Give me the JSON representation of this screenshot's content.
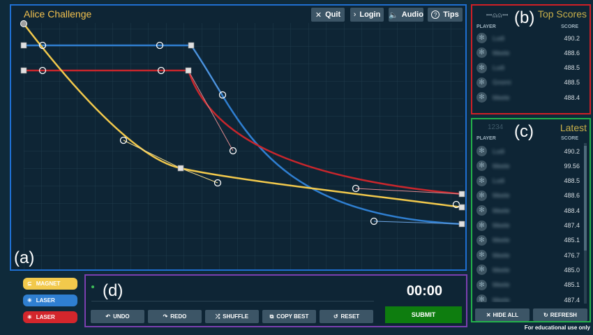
{
  "game": {
    "title": "Alice Challenge",
    "top_buttons": [
      {
        "label": "Quit",
        "icon": "close-icon",
        "glyph": "✕"
      },
      {
        "label": "Login",
        "icon": "chevron-right-icon",
        "glyph": "›"
      },
      {
        "label": "Audio",
        "icon": "speaker-icon",
        "glyph": "🔈"
      },
      {
        "label": "Tips",
        "icon": "question-icon",
        "glyph": "?"
      }
    ],
    "region_label": "(a)"
  },
  "top_scores": {
    "region_label": "(b)",
    "title": "Top Scores",
    "col_player": "PLAYER",
    "col_score": "SCORE",
    "rows": [
      {
        "name": "Ludi",
        "score": "490.2"
      },
      {
        "name": "Meele",
        "score": "488.6"
      },
      {
        "name": "Ludi",
        "score": "488.5"
      },
      {
        "name": "Gnomi",
        "score": "488.5"
      },
      {
        "name": "Meele",
        "score": "488.4"
      }
    ]
  },
  "latest": {
    "region_label": "(c)",
    "badge": "1234",
    "title": "Latest",
    "col_player": "PLAYER",
    "col_score": "SCORE",
    "rows": [
      {
        "name": "Ludi",
        "score": "490.2"
      },
      {
        "name": "Meele",
        "score": "99.56"
      },
      {
        "name": "Ludi",
        "score": "488.5"
      },
      {
        "name": "Meele",
        "score": "488.6"
      },
      {
        "name": "Meele",
        "score": "488.4"
      },
      {
        "name": "Meele",
        "score": "487.4"
      },
      {
        "name": "Meele",
        "score": "485.1"
      },
      {
        "name": "Meele",
        "score": "476.7"
      },
      {
        "name": "Meele",
        "score": "485.0"
      },
      {
        "name": "Meele",
        "score": "485.1"
      },
      {
        "name": "Meele",
        "score": "487.4"
      }
    ],
    "hide_all_label": "HIDE ALL",
    "refresh_label": "REFRESH"
  },
  "pieces": [
    {
      "label": "MAGNET",
      "color": "#f2c94c",
      "glyph": "⊆"
    },
    {
      "label": "LASER",
      "color": "#2f7fd1",
      "glyph": "✳"
    },
    {
      "label": "LASER",
      "color": "#d3262c",
      "glyph": "✳"
    }
  ],
  "controls": {
    "region_label": "(d)",
    "timer": "00:00",
    "buttons": [
      {
        "label": "UNDO",
        "glyph": "↶"
      },
      {
        "label": "REDO",
        "glyph": "↷"
      },
      {
        "label": "SHUFFLE",
        "glyph": "⤮"
      },
      {
        "label": "COPY BEST",
        "glyph": "⧉"
      },
      {
        "label": "RESET",
        "glyph": "↺"
      }
    ],
    "submit_label": "SUBMIT"
  },
  "footnote": "For educational use only",
  "colors": {
    "yellow_curve": "#f2c94c",
    "blue_curve": "#2f7fd1",
    "red_curve": "#c8262c",
    "panel_a": "#1f6fd1",
    "panel_b": "#d01f26",
    "panel_c": "#23b24a",
    "panel_d": "#7b3fb0"
  }
}
